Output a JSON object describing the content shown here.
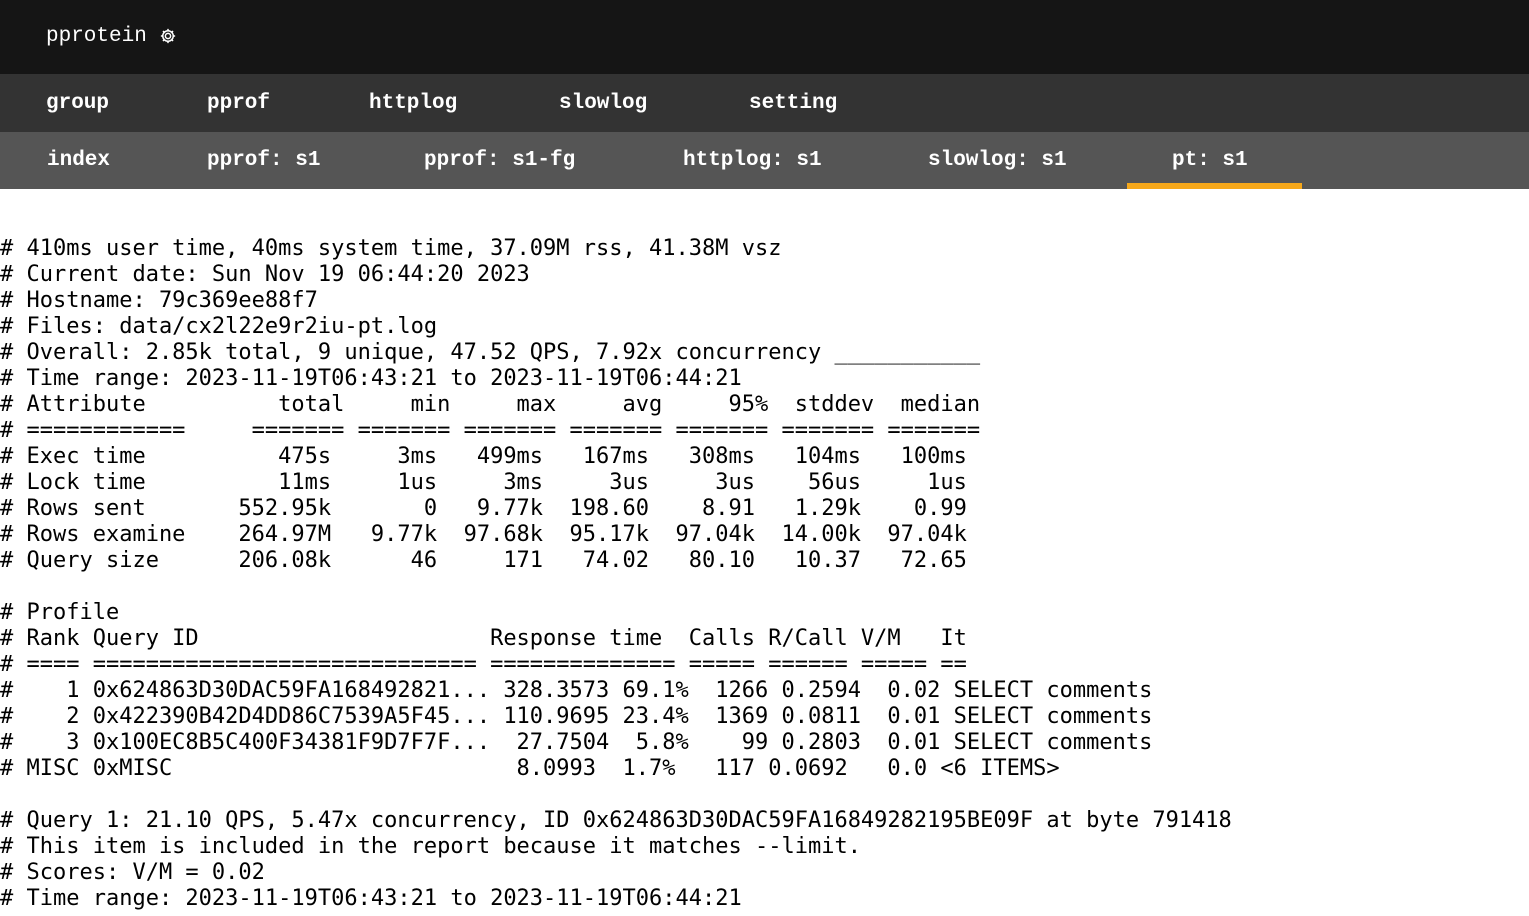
{
  "app": {
    "title": "pprotein",
    "settings_icon": "gear-icon"
  },
  "nav_primary": [
    {
      "label": "group"
    },
    {
      "label": "pprof"
    },
    {
      "label": "httplog"
    },
    {
      "label": "slowlog"
    },
    {
      "label": "setting"
    }
  ],
  "nav_secondary": [
    {
      "label": "index"
    },
    {
      "label": "pprof: s1"
    },
    {
      "label": "pprof: s1-fg"
    },
    {
      "label": "httplog: s1"
    },
    {
      "label": "slowlog: s1"
    },
    {
      "label": "pt: s1",
      "active": true
    }
  ],
  "colors": {
    "topbar": "#151515",
    "nav_primary_bg": "#333333",
    "nav_secondary_bg": "#555555",
    "active_accent": "#f6a81b"
  },
  "report": {
    "lines": [
      "# 410ms user time, 40ms system time, 37.09M rss, 41.38M vsz",
      "# Current date: Sun Nov 19 06:44:20 2023",
      "# Hostname: 79c369ee88f7",
      "# Files: data/cx2l22e9r2iu-pt.log",
      "# Overall: 2.85k total, 9 unique, 47.52 QPS, 7.92x concurrency ___________",
      "# Time range: 2023-11-19T06:43:21 to 2023-11-19T06:44:21",
      "# Attribute          total     min     max     avg     95%  stddev  median",
      "# ============     ======= ======= ======= ======= ======= ======= =======",
      "# Exec time          475s     3ms   499ms   167ms   308ms   104ms   100ms",
      "# Lock time          11ms     1us     3ms     3us     3us    56us     1us",
      "# Rows sent       552.95k       0   9.77k  198.60    8.91   1.29k    0.99",
      "# Rows examine    264.97M   9.77k  97.68k  95.17k  97.04k  14.00k  97.04k",
      "# Query size      206.08k      46     171   74.02   80.10   10.37   72.65",
      "",
      "# Profile",
      "# Rank Query ID                      Response time  Calls R/Call V/M   It",
      "# ==== ============================= ============== ===== ====== ===== ==",
      "#    1 0x624863D30DAC59FA168492821... 328.3573 69.1%  1266 0.2594  0.02 SELECT comments",
      "#    2 0x422390B42D4DD86C7539A5F45... 110.9695 23.4%  1369 0.0811  0.01 SELECT comments",
      "#    3 0x100EC8B5C400F34381F9D7F7F...  27.7504  5.8%    99 0.2803  0.01 SELECT comments",
      "# MISC 0xMISC                          8.0993  1.7%   117 0.0692   0.0 <6 ITEMS>",
      "",
      "# Query 1: 21.10 QPS, 5.47x concurrency, ID 0x624863D30DAC59FA16849282195BE09F at byte 791418",
      "# This item is included in the report because it matches --limit.",
      "# Scores: V/M = 0.02",
      "# Time range: 2023-11-19T06:43:21 to 2023-11-19T06:44:21"
    ]
  }
}
